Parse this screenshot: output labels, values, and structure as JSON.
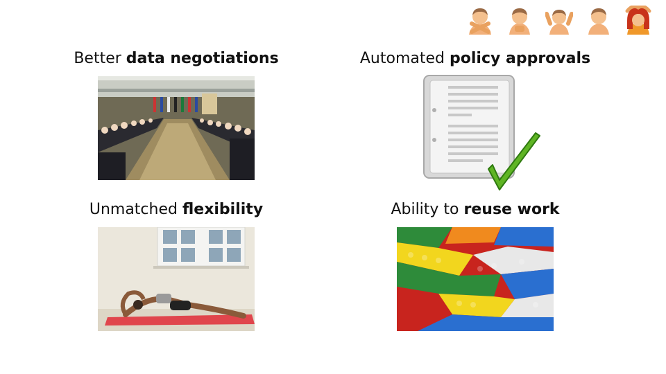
{
  "emoji_row": {
    "icons": [
      "person-gesturing-no-icon",
      "person-bowing-icon",
      "person-shrugging-icon",
      "person-neutral-icon",
      "person-gesturing-ok-icon"
    ]
  },
  "items": [
    {
      "prefix": "Better ",
      "bold": "data negotiations",
      "image": "negotiation-table-photo"
    },
    {
      "prefix": "Automated ",
      "bold": "policy approvals",
      "image": "document-checkmark-icon"
    },
    {
      "prefix": "Unmatched ",
      "bold": "flexibility",
      "image": "yoga-stretch-photo"
    },
    {
      "prefix": "Ability to ",
      "bold": "reuse work",
      "image": "lego-bricks-photo"
    }
  ]
}
